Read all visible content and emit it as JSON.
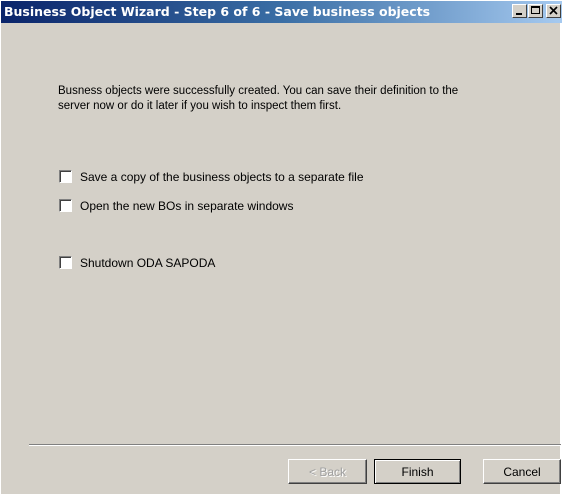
{
  "window": {
    "title": "Business Object Wizard - Step 6 of 6 - Save business objects"
  },
  "message": {
    "line1": "Busness objects were successfully created. You can save their definition to the",
    "line2": "server now or do it later if you wish to inspect them first."
  },
  "options": [
    {
      "label": "Save a copy of the business objects to a separate file",
      "checked": false
    },
    {
      "label": "Open the new BOs in separate windows",
      "checked": false
    },
    {
      "label": "Shutdown ODA SAPODA",
      "checked": false
    }
  ],
  "buttons": {
    "back": "< Back",
    "finish": "Finish",
    "cancel": "Cancel"
  },
  "title_buttons": [
    "minimize-icon",
    "maximize-icon",
    "close-icon"
  ]
}
